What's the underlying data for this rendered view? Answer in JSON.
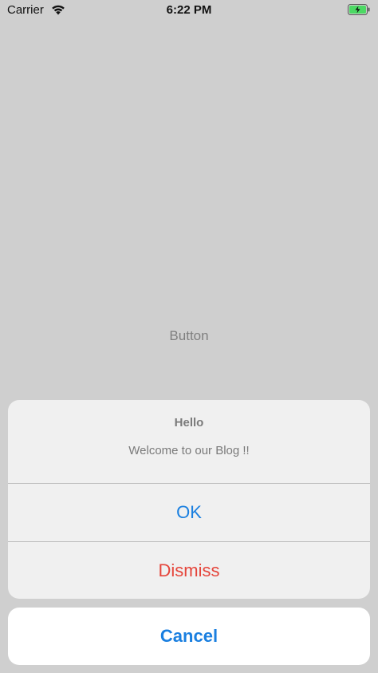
{
  "status_bar": {
    "carrier": "Carrier",
    "time": "6:22 PM",
    "wifi_icon": "wifi-icon",
    "battery_icon": "battery-charging-icon"
  },
  "main": {
    "button_label": "Button"
  },
  "action_sheet": {
    "title": "Hello",
    "message": "Welcome to our Blog !!",
    "actions": [
      {
        "label": "OK",
        "style": "default"
      },
      {
        "label": "Dismiss",
        "style": "destructive"
      }
    ],
    "cancel_label": "Cancel"
  },
  "colors": {
    "background": "#cfcfcf",
    "action_blue": "#1a7fe0",
    "destructive_red": "#e5453b",
    "battery_green": "#4cd964"
  }
}
